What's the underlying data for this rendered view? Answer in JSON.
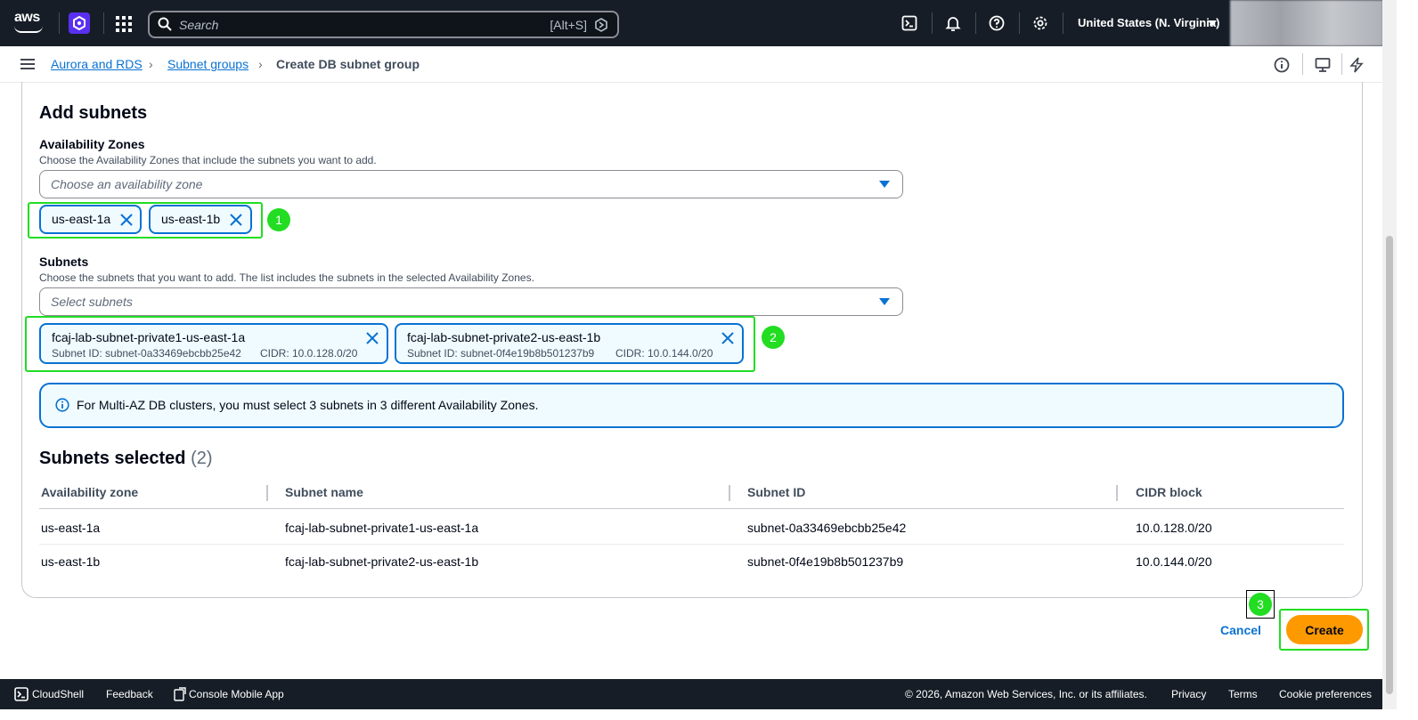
{
  "topnav": {
    "logo_text": "aws",
    "search_placeholder": "Search",
    "search_shortcut": "[Alt+S]",
    "region": "United States (N. Virginia)"
  },
  "breadcrumb": {
    "items": [
      "Aurora and RDS",
      "Subnet groups",
      "Create DB subnet group"
    ]
  },
  "add_subnets": {
    "title": "Add subnets",
    "az_label": "Availability Zones",
    "az_description": "Choose the Availability Zones that include the subnets you want to add.",
    "az_placeholder": "Choose an availability zone",
    "az_tokens": [
      "us-east-1a",
      "us-east-1b"
    ],
    "subnets_label": "Subnets",
    "subnets_description": "Choose the subnets that you want to add. The list includes the subnets in the selected Availability Zones.",
    "subnets_placeholder": "Select subnets",
    "subnet_tokens": [
      {
        "name": "fcaj-lab-subnet-private1-us-east-1a",
        "id": "Subnet ID: subnet-0a33469ebcbb25e42",
        "cidr": "CIDR: 10.0.128.0/20"
      },
      {
        "name": "fcaj-lab-subnet-private2-us-east-1b",
        "id": "Subnet ID: subnet-0f4e19b8b501237b9",
        "cidr": "CIDR: 10.0.144.0/20"
      }
    ],
    "alert": "For Multi-AZ DB clusters, you must select 3 subnets in 3 different Availability Zones."
  },
  "annotations": [
    "1",
    "2",
    "3"
  ],
  "selected": {
    "title": "Subnets selected",
    "count": "(2)",
    "columns": [
      "Availability zone",
      "Subnet name",
      "Subnet ID",
      "CIDR block"
    ],
    "rows": [
      [
        "us-east-1a",
        "fcaj-lab-subnet-private1-us-east-1a",
        "subnet-0a33469ebcbb25e42",
        "10.0.128.0/20"
      ],
      [
        "us-east-1b",
        "fcaj-lab-subnet-private2-us-east-1b",
        "subnet-0f4e19b8b501237b9",
        "10.0.144.0/20"
      ]
    ]
  },
  "actions": {
    "cancel": "Cancel",
    "create": "Create"
  },
  "footer": {
    "cloudshell": "CloudShell",
    "feedback": "Feedback",
    "mobile_app": "Console Mobile App",
    "copyright": "© 2026, Amazon Web Services, Inc. or its affiliates.",
    "privacy": "Privacy",
    "terms": "Terms",
    "cookies": "Cookie preferences"
  },
  "colors": {
    "nav_bg": "#161d26",
    "link": "#0972d3",
    "primary_button": "#ff9900",
    "highlight": "#22dd22"
  }
}
